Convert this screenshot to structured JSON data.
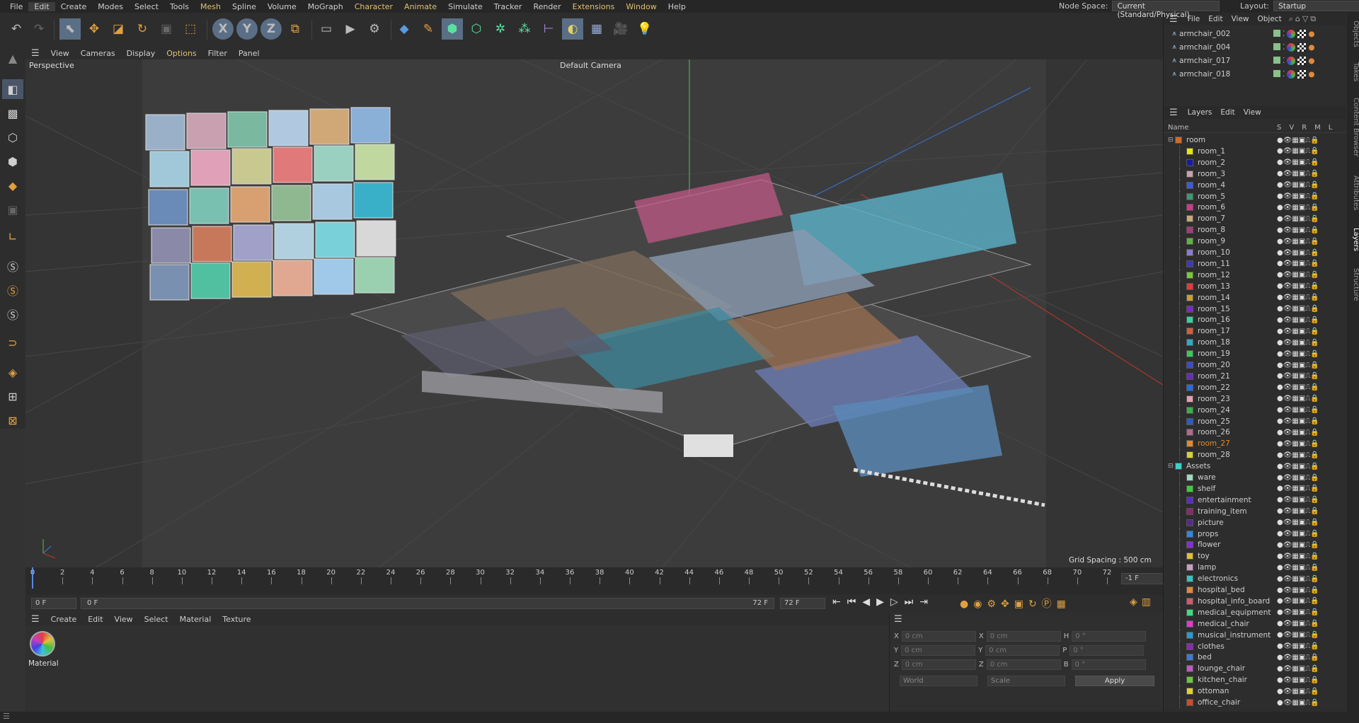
{
  "menu": {
    "items": [
      "File",
      "Edit",
      "Create",
      "Modes",
      "Select",
      "Tools",
      "Mesh",
      "Spline",
      "Volume",
      "MoGraph",
      "Character",
      "Animate",
      "Simulate",
      "Tracker",
      "Render",
      "Extensions",
      "Window",
      "Help"
    ],
    "node_space_label": "Node Space:",
    "node_space_value": "Current (Standard/Physical)",
    "layout_label": "Layout:",
    "layout_value": "Startup"
  },
  "viewport": {
    "menu": [
      "View",
      "Cameras",
      "Display",
      "Options",
      "Filter",
      "Panel"
    ],
    "label": "Perspective",
    "camera": "Default Camera",
    "grid_spacing": "Grid Spacing : 500 cm"
  },
  "timeline": {
    "ticks": [
      "0",
      "2",
      "4",
      "6",
      "8",
      "10",
      "12",
      "14",
      "16",
      "18",
      "20",
      "22",
      "24",
      "26",
      "28",
      "30",
      "32",
      "34",
      "36",
      "38",
      "40",
      "42",
      "44",
      "46",
      "48",
      "50",
      "52",
      "54",
      "56",
      "58",
      "60",
      "62",
      "64",
      "66",
      "68",
      "70",
      "72"
    ],
    "end_frame": "-1 F"
  },
  "transport": {
    "current": "0 F",
    "start": "0 F",
    "end_a": "72 F",
    "end_b": "72 F"
  },
  "material": {
    "menu": [
      "Create",
      "Edit",
      "View",
      "Select",
      "Material",
      "Texture"
    ],
    "name": "Material"
  },
  "coords": {
    "x": "0 cm",
    "y": "0 cm",
    "z": "0 cm",
    "sx": "0 cm",
    "sy": "0 cm",
    "sz": "0 cm",
    "h": "0 °",
    "p": "0 °",
    "b": "0 °",
    "mode": "World",
    "scale": "Scale",
    "apply": "Apply"
  },
  "objects": {
    "menu": [
      "File",
      "Edit",
      "View",
      "Object"
    ],
    "items": [
      "armchair_002",
      "armchair_004",
      "armchair_017",
      "armchair_018"
    ]
  },
  "layers": {
    "menu": [
      "Layers",
      "Edit",
      "View"
    ],
    "header_name": "Name",
    "header_flags": [
      "S",
      "V",
      "R",
      "M",
      "L"
    ],
    "items": [
      {
        "name": "room",
        "color": "#d06a2a",
        "group": true
      },
      {
        "name": "room_1",
        "color": "#e6e600"
      },
      {
        "name": "room_2",
        "color": "#1a1aa8"
      },
      {
        "name": "room_3",
        "color": "#c8a0b0"
      },
      {
        "name": "room_4",
        "color": "#3a5ae6"
      },
      {
        "name": "room_5",
        "color": "#3a9a70"
      },
      {
        "name": "room_6",
        "color": "#d03a8a"
      },
      {
        "name": "room_7",
        "color": "#c8a878"
      },
      {
        "name": "room_8",
        "color": "#a83a7a"
      },
      {
        "name": "room_9",
        "color": "#5ab83a"
      },
      {
        "name": "room_10",
        "color": "#8a7ad0"
      },
      {
        "name": "room_11",
        "color": "#3a3ab8"
      },
      {
        "name": "room_12",
        "color": "#7ac83a"
      },
      {
        "name": "room_13",
        "color": "#e63a3a"
      },
      {
        "name": "room_14",
        "color": "#c8a030"
      },
      {
        "name": "room_15",
        "color": "#7a2ac8"
      },
      {
        "name": "room_16",
        "color": "#3ad0a0"
      },
      {
        "name": "room_17",
        "color": "#d0603a"
      },
      {
        "name": "room_18",
        "color": "#30a8c8"
      },
      {
        "name": "room_19",
        "color": "#3ac858"
      },
      {
        "name": "room_20",
        "color": "#3a4ad0"
      },
      {
        "name": "room_21",
        "color": "#6a2ac0"
      },
      {
        "name": "room_22",
        "color": "#2a6ae0"
      },
      {
        "name": "room_23",
        "color": "#e0a0b0"
      },
      {
        "name": "room_24",
        "color": "#3ab04a"
      },
      {
        "name": "room_25",
        "color": "#2a5ad0"
      },
      {
        "name": "room_26",
        "color": "#b06a8a"
      },
      {
        "name": "room_27",
        "color": "#e08a2a",
        "highlight": true
      },
      {
        "name": "room_28",
        "color": "#d8d030"
      },
      {
        "name": "Assets",
        "color": "#3ad0c8",
        "group": true
      },
      {
        "name": "ware",
        "color": "#a0d8c0"
      },
      {
        "name": "shelf",
        "color": "#3ad03a"
      },
      {
        "name": "entertainment",
        "color": "#5a2ad0"
      },
      {
        "name": "training_item",
        "color": "#8a2a6a"
      },
      {
        "name": "picture",
        "color": "#5a2a8a"
      },
      {
        "name": "props",
        "color": "#2a8ae0"
      },
      {
        "name": "flower",
        "color": "#8a2ae0"
      },
      {
        "name": "toy",
        "color": "#e0c030"
      },
      {
        "name": "lamp",
        "color": "#c8a0c0"
      },
      {
        "name": "electronics",
        "color": "#3ac0c0"
      },
      {
        "name": "hospital_bed",
        "color": "#e08a3a"
      },
      {
        "name": "hospital_info_board",
        "color": "#d05a6a"
      },
      {
        "name": "medical_equipment",
        "color": "#3ae07a"
      },
      {
        "name": "medical_chair",
        "color": "#e03ad0"
      },
      {
        "name": "musical_instrument",
        "color": "#2a9ad0"
      },
      {
        "name": "clothes",
        "color": "#8a2ab0"
      },
      {
        "name": "bed",
        "color": "#3a7ae0"
      },
      {
        "name": "lounge_chair",
        "color": "#c05ac8"
      },
      {
        "name": "kitchen_chair",
        "color": "#6ac83a"
      },
      {
        "name": "ottoman",
        "color": "#e0d030"
      },
      {
        "name": "office_chair",
        "color": "#d04a2a"
      }
    ]
  },
  "side_tabs": [
    "Objects",
    "Takes",
    "Content Browser",
    "Attributes",
    "Layers",
    "Structure"
  ],
  "colors": {
    "accent": "#5a6e86",
    "highlight_text": "#e08a2a",
    "menu_highlight": "#e0c070"
  }
}
